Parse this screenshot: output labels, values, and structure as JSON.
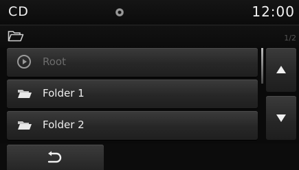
{
  "status_bar": {
    "source": "CD",
    "disc_icon": "disc-icon",
    "clock": "12:00"
  },
  "path_row": {
    "icon": "open-folder-icon",
    "page_indicator": "1/2"
  },
  "list": {
    "items": [
      {
        "label": "Root",
        "icon": "play-circle-icon",
        "enabled": false
      },
      {
        "label": "Folder 1",
        "icon": "folder-icon",
        "enabled": true
      },
      {
        "label": "Folder 2",
        "icon": "folder-icon",
        "enabled": true
      }
    ]
  },
  "scroll": {
    "up_icon": "arrow-up-icon",
    "down_icon": "arrow-down-icon"
  },
  "bottom_bar": {
    "back_icon": "back-arrow-icon"
  },
  "colors": {
    "background": "#0a0a0a",
    "button_face": "#2e2e2e",
    "text": "#efefef",
    "disabled_text": "#6c6c6c"
  }
}
